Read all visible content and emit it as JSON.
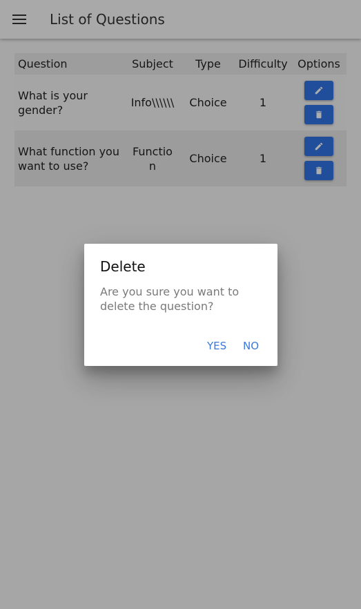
{
  "appbar": {
    "title": "List of Questions",
    "menu_icon": "menu-icon"
  },
  "table": {
    "headers": {
      "question": "Question",
      "subject": "Subject",
      "type": "Type",
      "difficulty": "Difficulty",
      "options": "Options"
    },
    "rows": [
      {
        "question": "What is your gender?",
        "subject": "Info\\\\\\\\\\\\",
        "type": "Choice",
        "difficulty": "1"
      },
      {
        "question": "What function you want to use?",
        "subject": "Function",
        "type": "Choice",
        "difficulty": "1"
      }
    ],
    "edit_icon": "pencil-icon",
    "delete_icon": "trash-icon"
  },
  "dialog": {
    "title": "Delete",
    "message": "Are you sure you want to delete the question?",
    "yes_label": "YES",
    "no_label": "NO"
  },
  "colors": {
    "accent": "#3273e5",
    "dialog_button": "#3a78e0",
    "scrim": "rgba(0,0,0,0.32)"
  }
}
